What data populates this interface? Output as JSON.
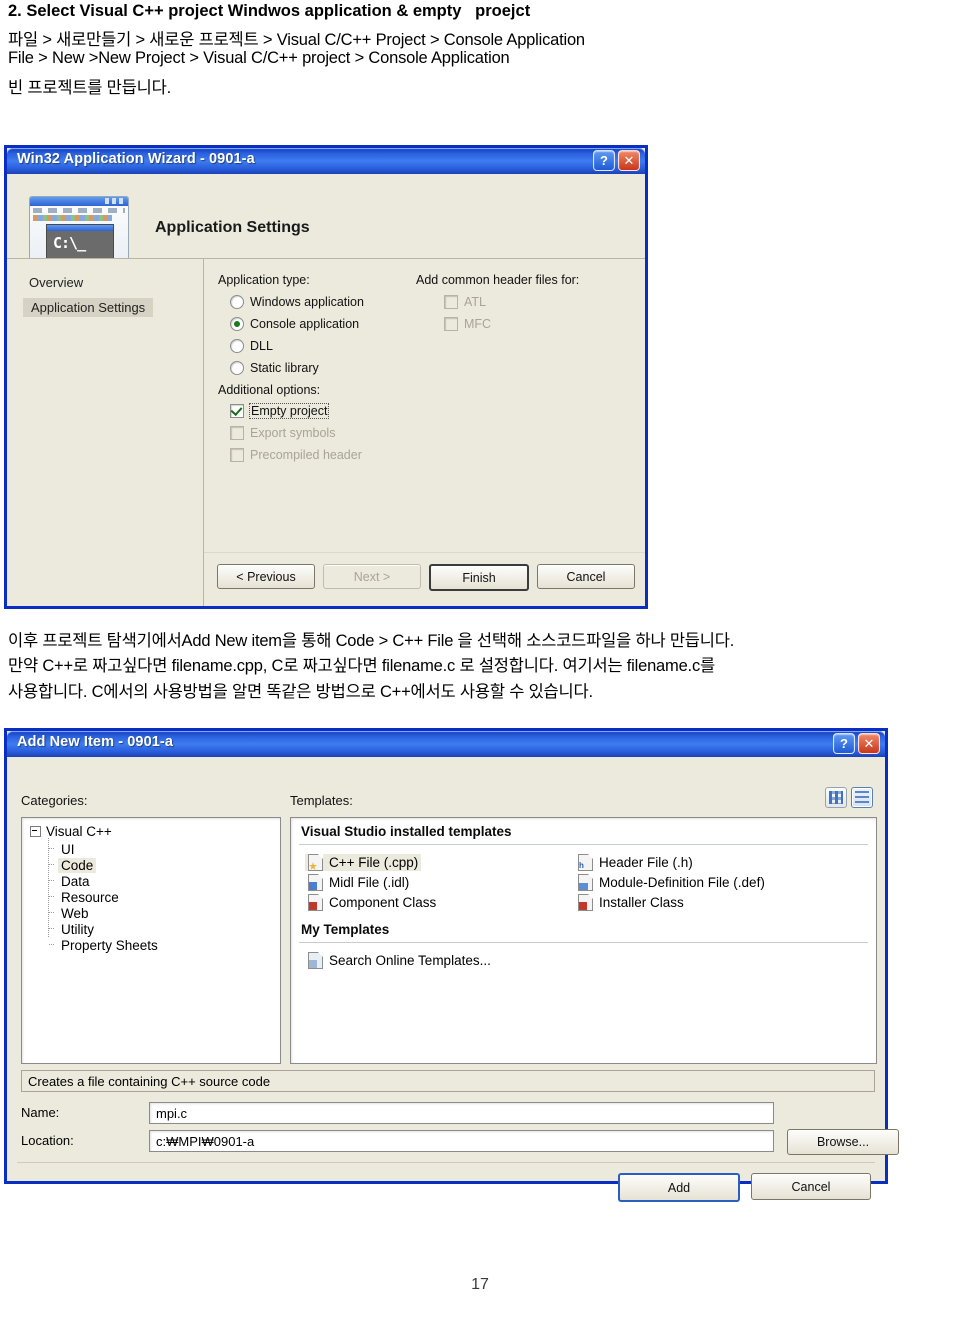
{
  "document": {
    "heading": "2. Select Visual C++ project Windwos application & empty   proejct",
    "line1": "파일 > 새로만들기 > 새로운 프로젝트 > Visual C/C++ Project > Console Application",
    "line2": "File > New >New Project > Visual C/C++ project > Console Application",
    "line3": "빈 프로젝트를 만듭니다.",
    "mid1": "이후 프로젝트 탐색기에서Add New item을 통해 Code > C++ File 을 선택해 소스코드파일을 하나 만듭니다.",
    "mid2": "만약 C++로 짜고싶다면 filename.cpp, C로 짜고싶다면 filename.c 로 설정합니다. 여기서는 filename.c를",
    "mid3": "사용합니다. C에서의 사용방법을 알면 똑같은 방법으로 C++에서도 사용할 수 있습니다.",
    "page_number": "17"
  },
  "wizard": {
    "title": "Win32 Application Wizard - 0901-a",
    "help_glyph": "?",
    "close_glyph": "✕",
    "header_title": "Application Settings",
    "icon_console_text": "C:\\_",
    "nav": [
      {
        "label": "Overview",
        "selected": false
      },
      {
        "label": "Application Settings",
        "selected": true
      }
    ],
    "app_type_label": "Application type:",
    "app_types": [
      {
        "label": "Windows application",
        "mnemonic": "Wi",
        "selected": false,
        "enabled": true
      },
      {
        "label": "Console application",
        "mnemonic": "Co",
        "selected": true,
        "enabled": true
      },
      {
        "label": "DLL",
        "mnemonic": "DL",
        "selected": false,
        "enabled": true
      },
      {
        "label": "Static library",
        "mnemonic": "St",
        "selected": false,
        "enabled": true
      }
    ],
    "additional_label": "Additional options:",
    "additional_options": [
      {
        "label": "Empty project",
        "checked": true,
        "enabled": true,
        "focused": true
      },
      {
        "label": "Export symbols",
        "checked": false,
        "enabled": false,
        "focused": false
      },
      {
        "label": "Precompiled header",
        "checked": false,
        "enabled": false,
        "focused": false
      }
    ],
    "headers_label": "Add common header files for:",
    "header_options": [
      {
        "label": "ATL",
        "checked": false,
        "enabled": false
      },
      {
        "label": "MFC",
        "checked": false,
        "enabled": false
      }
    ],
    "buttons": [
      {
        "label": "< Previous",
        "enabled": true,
        "default": false
      },
      {
        "label": "Next >",
        "enabled": false,
        "default": false
      },
      {
        "label": "Finish",
        "enabled": true,
        "default": true
      },
      {
        "label": "Cancel",
        "enabled": true,
        "default": false
      }
    ]
  },
  "additem": {
    "title": "Add New Item - 0901-a",
    "help_glyph": "?",
    "close_glyph": "✕",
    "categories_label": "Categories:",
    "templates_label": "Templates:",
    "tree_root": "Visual C++",
    "tree_children": [
      {
        "label": "UI",
        "selected": false
      },
      {
        "label": "Code",
        "selected": true
      },
      {
        "label": "Data",
        "selected": false
      },
      {
        "label": "Resource",
        "selected": false
      },
      {
        "label": "Web",
        "selected": false
      },
      {
        "label": "Utility",
        "selected": false
      },
      {
        "label": "Property Sheets",
        "selected": false
      }
    ],
    "installed_header": "Visual Studio installed templates",
    "templates_col1": [
      {
        "label": "C++ File (.cpp)",
        "icon": "cpp-file-icon",
        "selected": true
      },
      {
        "label": "Midl File (.idl)",
        "icon": "idl-file-icon",
        "selected": false
      },
      {
        "label": "Component Class",
        "icon": "component-class-icon",
        "selected": false
      }
    ],
    "templates_col2": [
      {
        "label": "Header File (.h)",
        "icon": "header-file-icon",
        "selected": false
      },
      {
        "label": "Module-Definition File (.def)",
        "icon": "def-file-icon",
        "selected": false
      },
      {
        "label": "Installer Class",
        "icon": "installer-class-icon",
        "selected": false
      }
    ],
    "my_templates_header": "My Templates",
    "my_templates": [
      {
        "label": "Search Online Templates...",
        "icon": "search-online-icon",
        "selected": false
      }
    ],
    "view_buttons": [
      {
        "name": "large-icons-view",
        "active": false
      },
      {
        "name": "list-view",
        "active": true
      }
    ],
    "description": "Creates a file containing C++ source code",
    "name_label": "Name:",
    "name_value": "mpi.c",
    "location_label": "Location:",
    "location_value": "c:₩MPI₩0901-a",
    "browse_label": "Browse...",
    "buttons": [
      {
        "label": "Add",
        "default": true
      },
      {
        "label": "Cancel",
        "default": false
      }
    ]
  },
  "colors": {
    "title_blue": "#1c49c6",
    "dialog_border": "#0a2ec4",
    "panel_beige": "#ece9dd",
    "selection_beige": "#d6d2c4",
    "radio_green": "#1b7a1b"
  }
}
